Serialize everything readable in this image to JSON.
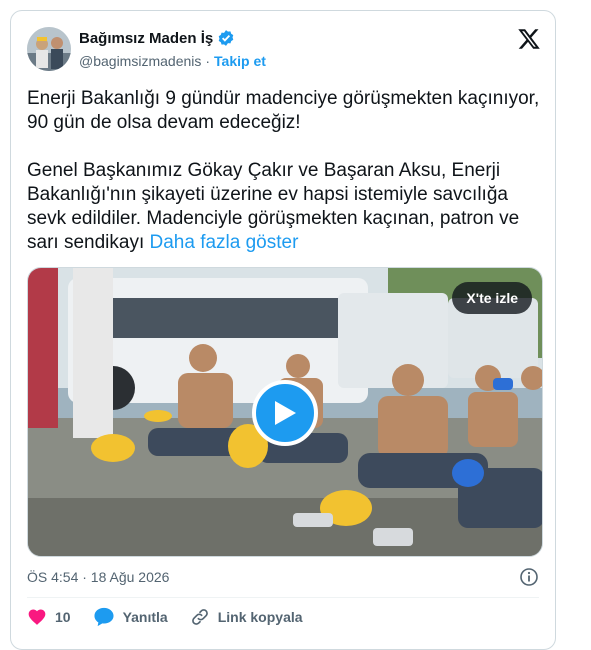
{
  "account": {
    "name": "Bağımsız Maden İş",
    "handle": "@bagimsizmadenis",
    "separator": "·",
    "follow_label": "Takip et"
  },
  "tweet": {
    "text": "Enerji Bakanlığı 9 gündür madenciye görüşmekten kaçınıyor, 90 gün de olsa devam edeceğiz!\n\nGenel Başkanımız Gökay Çakır ve Başaran Aksu, Enerji Bakanlığı'nın şikayeti üzerine ev hapsi istemiyle savcılığa sevk edildiler. Madenciyle görüşmekten kaçınan, patron ve sarı sendikayı ",
    "show_more": "Daha fazla göster"
  },
  "media": {
    "badge": "X'te izle",
    "play_icon": "play-icon"
  },
  "meta": {
    "timestamp": "ÖS 4:54 · 18 Ağu 2026"
  },
  "actions": {
    "like_count": "10",
    "reply_label": "Yanıtla",
    "copy_link_label": "Link kopyala"
  },
  "colors": {
    "accent": "#1d9bf0",
    "like": "#f91880",
    "text": "#0f1419",
    "muted": "#536471"
  }
}
